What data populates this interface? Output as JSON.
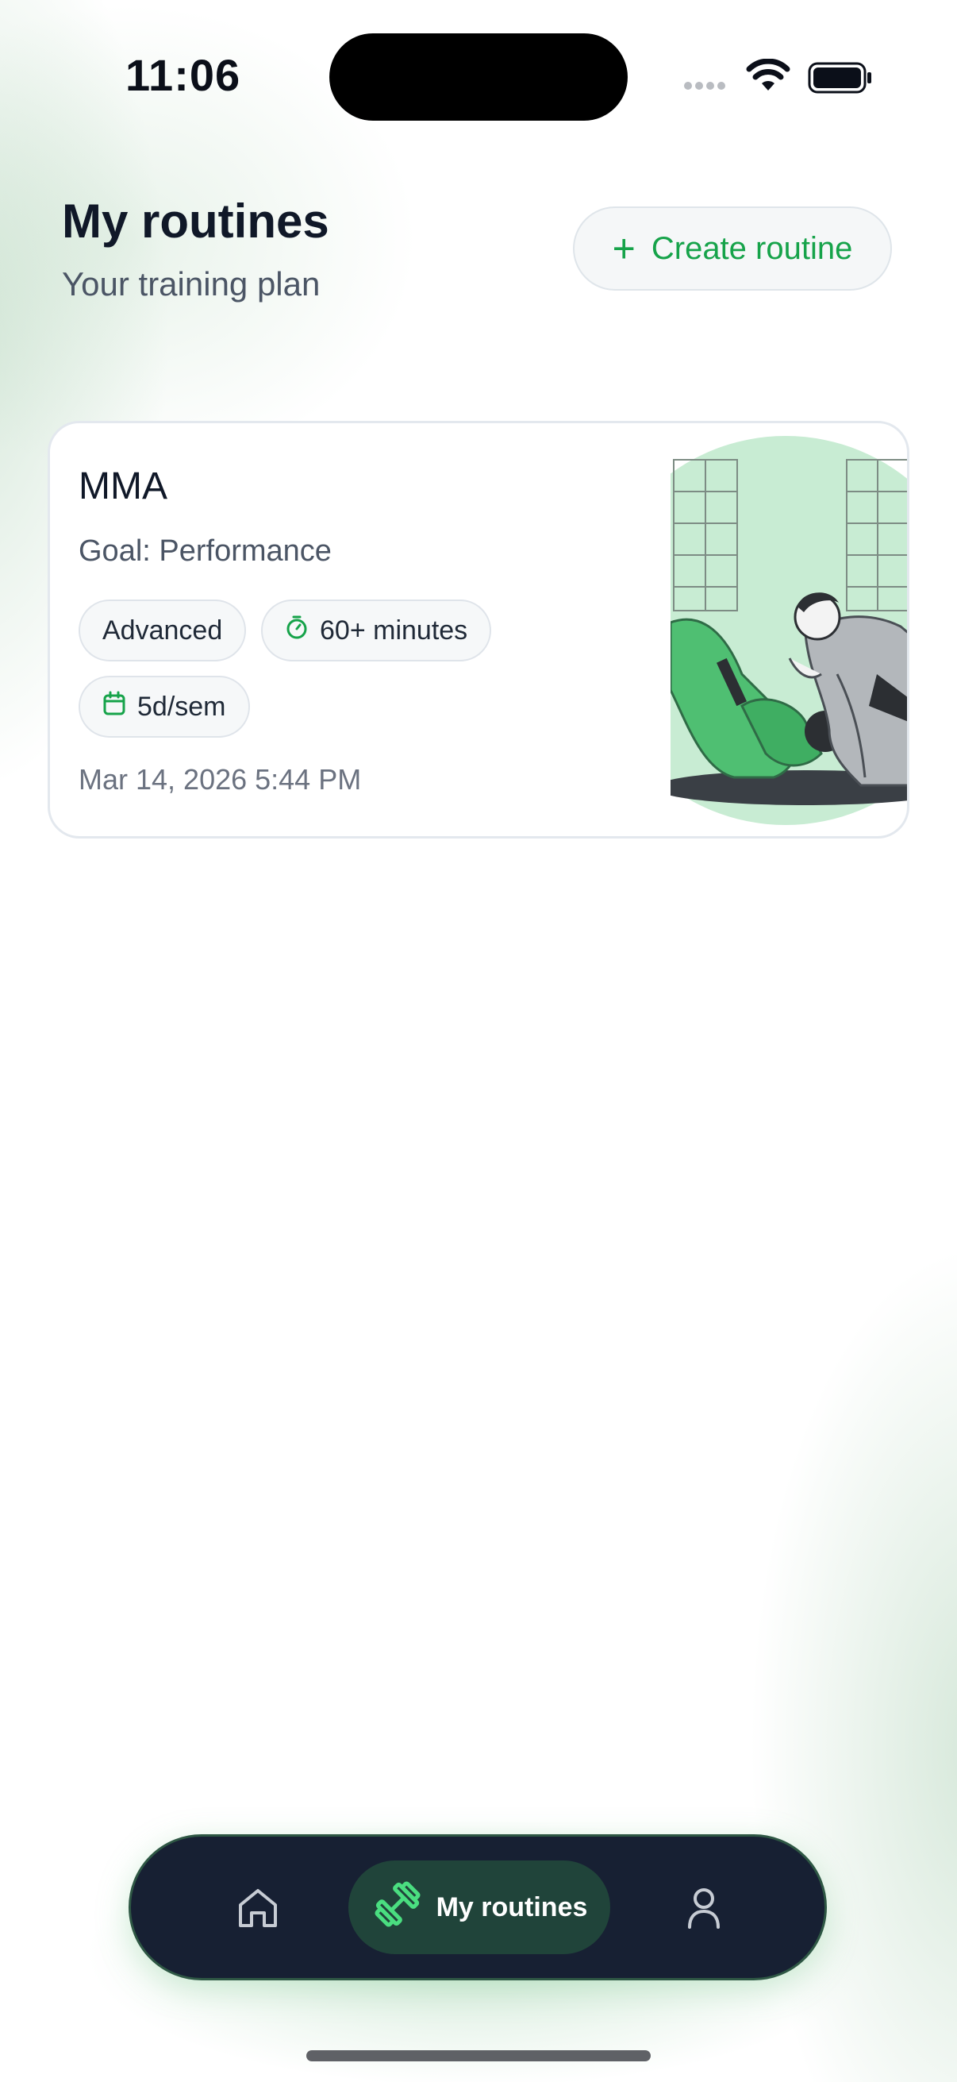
{
  "status_bar": {
    "time": "11:06"
  },
  "header": {
    "title": "My routines",
    "subtitle": "Your training plan",
    "create_button_label": "Create routine"
  },
  "routines": [
    {
      "name": "MMA",
      "goal": "Goal: Performance",
      "level": "Advanced",
      "duration": "60+ minutes",
      "frequency": "5d/sem",
      "date": "Mar 14, 2026 5:44 PM",
      "illustration": "martial-arts-grappling-illustration"
    }
  ],
  "bottom_nav": {
    "items": [
      {
        "name": "home",
        "icon": "home-icon"
      },
      {
        "name": "my-routines",
        "icon": "dumbbell-icon",
        "label": "My routines",
        "active": true
      },
      {
        "name": "profile",
        "icon": "user-icon"
      }
    ]
  },
  "colors": {
    "accent": "#16a34a",
    "nav_background": "#172033",
    "nav_active": "#20443a",
    "text_primary": "#101828",
    "text_secondary": "#4b5565"
  }
}
